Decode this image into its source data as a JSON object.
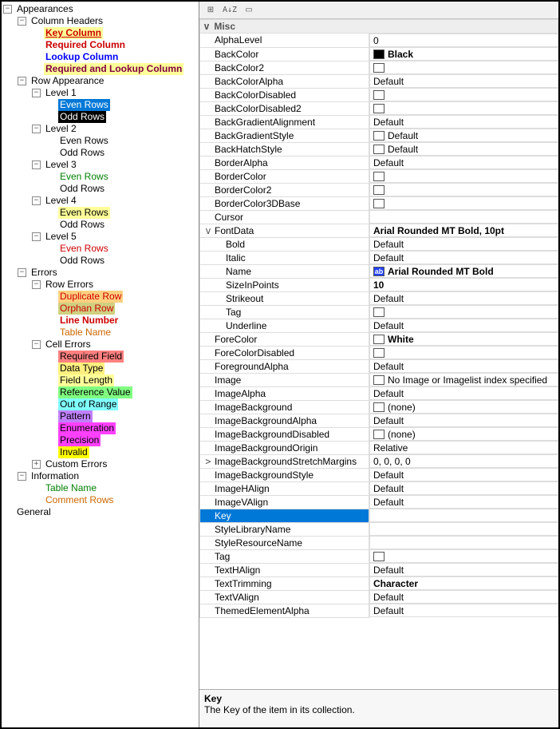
{
  "tree": {
    "appearances": "Appearances",
    "column_headers": "Column Headers",
    "ch_key": "Key Column",
    "ch_req": "Required Column",
    "ch_look": "Lookup Column",
    "ch_reqlook": "Required and Lookup Column",
    "row_app": "Row Appearance",
    "level1": "Level 1",
    "level2": "Level 2",
    "level3": "Level 3",
    "level4": "Level 4",
    "level5": "Level 5",
    "even": "Even Rows",
    "odd": "Odd Rows",
    "errors": "Errors",
    "row_err": "Row Errors",
    "dup": "Duplicate Row",
    "orphan": "Orphan Row",
    "lineno": "Line Number",
    "tname": "Table Name",
    "cell_err": "Cell Errors",
    "reqf": "Required Field",
    "dtype": "Data Type",
    "flen": "Field Length",
    "refv": "Reference Value",
    "oor": "Out of Range",
    "pat": "Pattern",
    "enum": "Enumeration",
    "prec": "Precision",
    "inv": "Invalid",
    "cust": "Custom Errors",
    "info": "Information",
    "tname2": "Table Name",
    "crow": "Comment Rows",
    "general": "General"
  },
  "toolbar": {
    "categorized": "⊞",
    "alpha": "A↓Z",
    "pages": "▭"
  },
  "category_misc": "Misc",
  "props": {
    "AlphaLevel": {
      "n": "AlphaLevel",
      "v": "0"
    },
    "BackColor": {
      "n": "BackColor",
      "v": "Black",
      "swatch": "black",
      "bold": true
    },
    "BackColor2": {
      "n": "BackColor2",
      "v": "",
      "swatch": "empty"
    },
    "BackColorAlpha": {
      "n": "BackColorAlpha",
      "v": "Default"
    },
    "BackColorDisabled": {
      "n": "BackColorDisabled",
      "v": "",
      "swatch": "empty"
    },
    "BackColorDisabled2": {
      "n": "BackColorDisabled2",
      "v": "",
      "swatch": "empty"
    },
    "BackGradientAlignment": {
      "n": "BackGradientAlignment",
      "v": "Default"
    },
    "BackGradientStyle": {
      "n": "BackGradientStyle",
      "v": "Default",
      "swatch": "empty"
    },
    "BackHatchStyle": {
      "n": "BackHatchStyle",
      "v": "Default",
      "swatch": "empty"
    },
    "BorderAlpha": {
      "n": "BorderAlpha",
      "v": "Default"
    },
    "BorderColor": {
      "n": "BorderColor",
      "v": "",
      "swatch": "empty"
    },
    "BorderColor2": {
      "n": "BorderColor2",
      "v": "",
      "swatch": "empty"
    },
    "BorderColor3DBase": {
      "n": "BorderColor3DBase",
      "v": "",
      "swatch": "empty"
    },
    "Cursor": {
      "n": "Cursor",
      "v": ""
    },
    "FontData": {
      "n": "FontData",
      "v": "Arial Rounded MT Bold, 10pt",
      "bold": true,
      "exp": "v"
    },
    "Bold": {
      "n": "Bold",
      "v": "Default",
      "child": true
    },
    "Italic": {
      "n": "Italic",
      "v": "Default",
      "child": true
    },
    "Name": {
      "n": "Name",
      "v": "Arial Rounded MT Bold",
      "child": true,
      "bold": true,
      "swatch": "ab",
      "swatchtext": "ab"
    },
    "SizeInPoints": {
      "n": "SizeInPoints",
      "v": "10",
      "child": true,
      "bold": true
    },
    "Strikeout": {
      "n": "Strikeout",
      "v": "Default",
      "child": true
    },
    "Tag": {
      "n": "Tag",
      "v": "",
      "child": true,
      "swatch": "empty"
    },
    "Underline": {
      "n": "Underline",
      "v": "Default",
      "child": true
    },
    "ForeColor": {
      "n": "ForeColor",
      "v": "White",
      "swatch": "white",
      "bold": true
    },
    "ForeColorDisabled": {
      "n": "ForeColorDisabled",
      "v": "",
      "swatch": "empty"
    },
    "ForegroundAlpha": {
      "n": "ForegroundAlpha",
      "v": "Default"
    },
    "Image": {
      "n": "Image",
      "v": "No Image or Imagelist index specified",
      "swatch": "empty"
    },
    "ImageAlpha": {
      "n": "ImageAlpha",
      "v": "Default"
    },
    "ImageBackground": {
      "n": "ImageBackground",
      "v": "(none)",
      "swatch": "empty"
    },
    "ImageBackgroundAlpha": {
      "n": "ImageBackgroundAlpha",
      "v": "Default"
    },
    "ImageBackgroundDisabled": {
      "n": "ImageBackgroundDisabled",
      "v": "(none)",
      "swatch": "empty"
    },
    "ImageBackgroundOrigin": {
      "n": "ImageBackgroundOrigin",
      "v": "Relative"
    },
    "ImageBackgroundStretchMargins": {
      "n": "ImageBackgroundStretchMargins",
      "v": "0, 0, 0, 0",
      "exp": ">"
    },
    "ImageBackgroundStyle": {
      "n": "ImageBackgroundStyle",
      "v": "Default"
    },
    "ImageHAlign": {
      "n": "ImageHAlign",
      "v": "Default"
    },
    "ImageVAlign": {
      "n": "ImageVAlign",
      "v": "Default"
    },
    "Key": {
      "n": "Key",
      "v": "",
      "selected": true
    },
    "StyleLibraryName": {
      "n": "StyleLibraryName",
      "v": ""
    },
    "StyleResourceName": {
      "n": "StyleResourceName",
      "v": ""
    },
    "Tag2": {
      "n": "Tag",
      "v": "",
      "swatch": "empty"
    },
    "TextHAlign": {
      "n": "TextHAlign",
      "v": "Default"
    },
    "TextTrimming": {
      "n": "TextTrimming",
      "v": "Character",
      "bold": true
    },
    "TextVAlign": {
      "n": "TextVAlign",
      "v": "Default"
    },
    "ThemedElementAlpha": {
      "n": "ThemedElementAlpha",
      "v": "Default"
    }
  },
  "order": [
    "AlphaLevel",
    "BackColor",
    "BackColor2",
    "BackColorAlpha",
    "BackColorDisabled",
    "BackColorDisabled2",
    "BackGradientAlignment",
    "BackGradientStyle",
    "BackHatchStyle",
    "BorderAlpha",
    "BorderColor",
    "BorderColor2",
    "BorderColor3DBase",
    "Cursor",
    "FontData",
    "Bold",
    "Italic",
    "Name",
    "SizeInPoints",
    "Strikeout",
    "Tag",
    "Underline",
    "ForeColor",
    "ForeColorDisabled",
    "ForegroundAlpha",
    "Image",
    "ImageAlpha",
    "ImageBackground",
    "ImageBackgroundAlpha",
    "ImageBackgroundDisabled",
    "ImageBackgroundOrigin",
    "ImageBackgroundStretchMargins",
    "ImageBackgroundStyle",
    "ImageHAlign",
    "ImageVAlign",
    "Key",
    "StyleLibraryName",
    "StyleResourceName",
    "Tag2",
    "TextHAlign",
    "TextTrimming",
    "TextVAlign",
    "ThemedElementAlpha"
  ],
  "description": {
    "title": "Key",
    "body": "The Key of the item in its collection."
  }
}
